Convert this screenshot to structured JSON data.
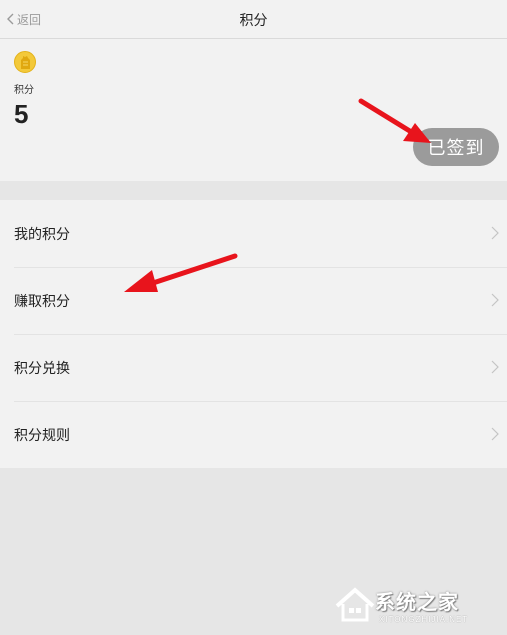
{
  "header": {
    "back_label": "返回",
    "title": "积分"
  },
  "summary": {
    "coin_icon": "coin-icon",
    "points_label": "积分",
    "points_value": "5",
    "signin_label": "已签到",
    "coin_color": "#f3c93a"
  },
  "menu": {
    "items": [
      {
        "label": "我的积分"
      },
      {
        "label": "赚取积分"
      },
      {
        "label": "积分兑换"
      },
      {
        "label": "积分规则"
      }
    ]
  },
  "annotations": {
    "arrow_color": "#e8141c"
  },
  "watermark": {
    "title": "系统之家",
    "subtitle": "XITONGZHIJIA.NET"
  }
}
